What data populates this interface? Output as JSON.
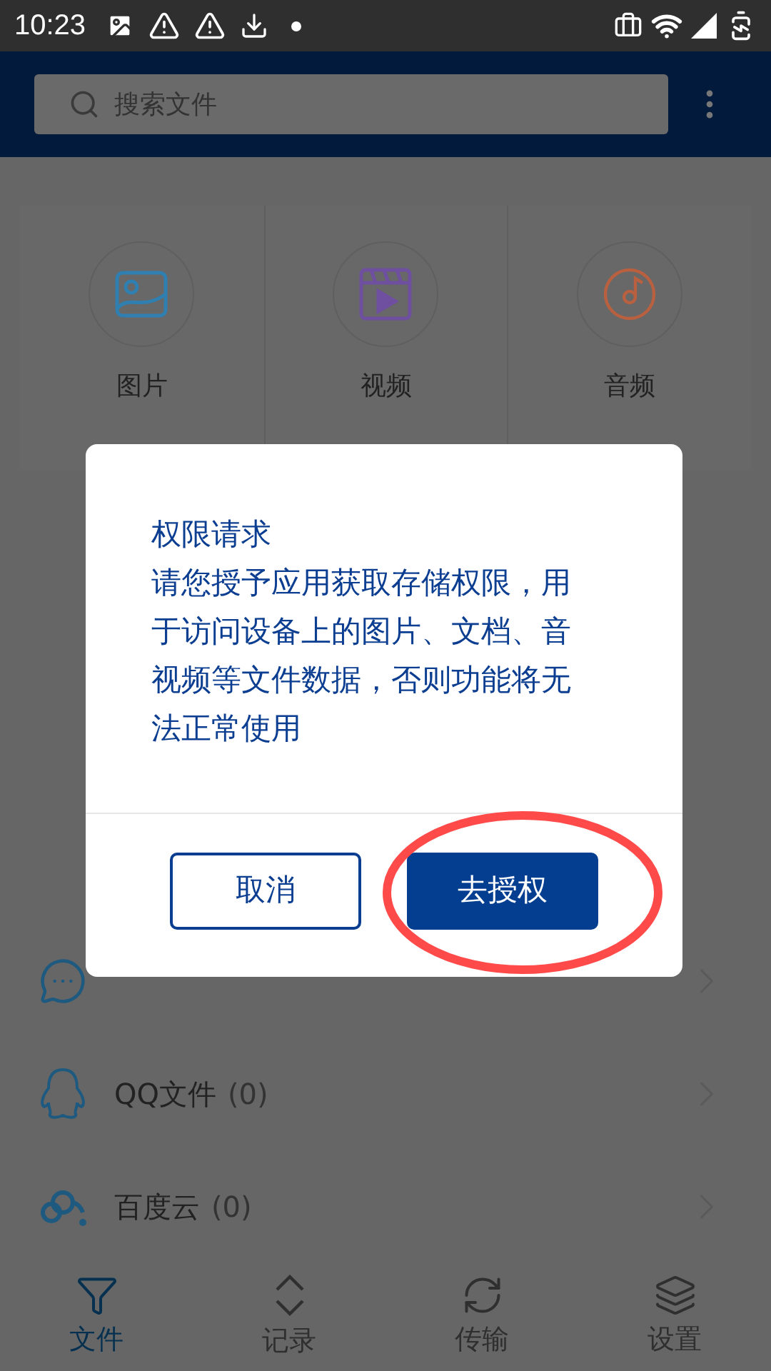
{
  "status_bar": {
    "time": "10:23"
  },
  "search": {
    "placeholder": "搜索文件"
  },
  "categories": [
    {
      "label": "图片",
      "kind": "image"
    },
    {
      "label": "视频",
      "kind": "video"
    },
    {
      "label": "音频",
      "kind": "audio"
    }
  ],
  "sources": [
    {
      "kind": "wechat"
    },
    {
      "name": "QQ文件",
      "count": "(0)",
      "kind": "qq"
    },
    {
      "name": "百度云",
      "count": "(0)",
      "kind": "cloud"
    }
  ],
  "tabs": [
    {
      "label": "文件",
      "selected": true,
      "kind": "files"
    },
    {
      "label": "记录",
      "selected": false,
      "kind": "records"
    },
    {
      "label": "传输",
      "selected": false,
      "kind": "transfer"
    },
    {
      "label": "设置",
      "selected": false,
      "kind": "settings"
    }
  ],
  "dialog": {
    "title": "权限请求",
    "message": "请您授予应用获取存储权限，用于访问设备上的图片、文档、音视频等文件数据，否则功能将无法正常使用",
    "buttons": [
      {
        "label": "取消",
        "kind": "secondary",
        "circled": false
      },
      {
        "label": "去授权",
        "kind": "primary",
        "circled": true
      }
    ]
  }
}
